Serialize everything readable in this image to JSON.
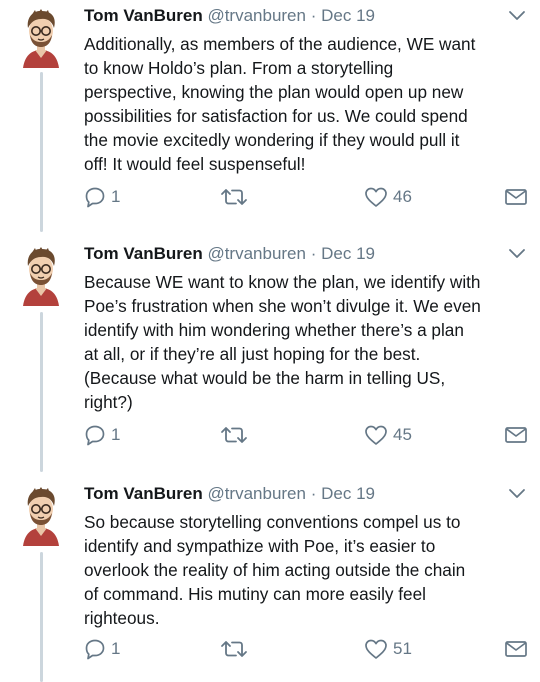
{
  "colors": {
    "text": "#14171a",
    "secondary": "#657786",
    "thread_line": "#ccd6dd",
    "background": "#ffffff"
  },
  "icons": {
    "reply": "speech-bubble-icon",
    "retweet": "retweet-arrows-icon",
    "like": "heart-icon",
    "dm": "envelope-icon",
    "menu": "chevron-down-icon"
  },
  "tweets": [
    {
      "name": "Tom VanBuren",
      "handle": "@trvanburen",
      "separator": "·",
      "date": "Dec 19",
      "text": "Additionally, as members of the audience, WE want\nto know Holdo’s plan. From a storytelling\nperspective, knowing the plan would open up new\npossibilities for satisfaction for us. We could spend\nthe movie excitedly wondering if they would pull it\noff! It would feel suspenseful!",
      "replies": "1",
      "likes": "46"
    },
    {
      "name": "Tom VanBuren",
      "handle": "@trvanburen",
      "separator": "·",
      "date": "Dec 19",
      "text": "Because WE want to know the plan, we identify with\nPoe’s frustration when she won’t divulge it. We even\nidentify with him wondering whether there’s a plan\nat all, or if they’re all just hoping for the best.\n(Because what would be the harm in telling US,\nright?)",
      "replies": "1",
      "likes": "45"
    },
    {
      "name": "Tom VanBuren",
      "handle": "@trvanburen",
      "separator": "·",
      "date": "Dec 19",
      "text": "So because storytelling conventions compel us to\nidentify and sympathize with Poe, it’s easier to\noverlook the reality of him acting outside the chain\nof command. His mutiny can more easily feel\nrighteous.",
      "replies": "1",
      "likes": "51"
    }
  ]
}
